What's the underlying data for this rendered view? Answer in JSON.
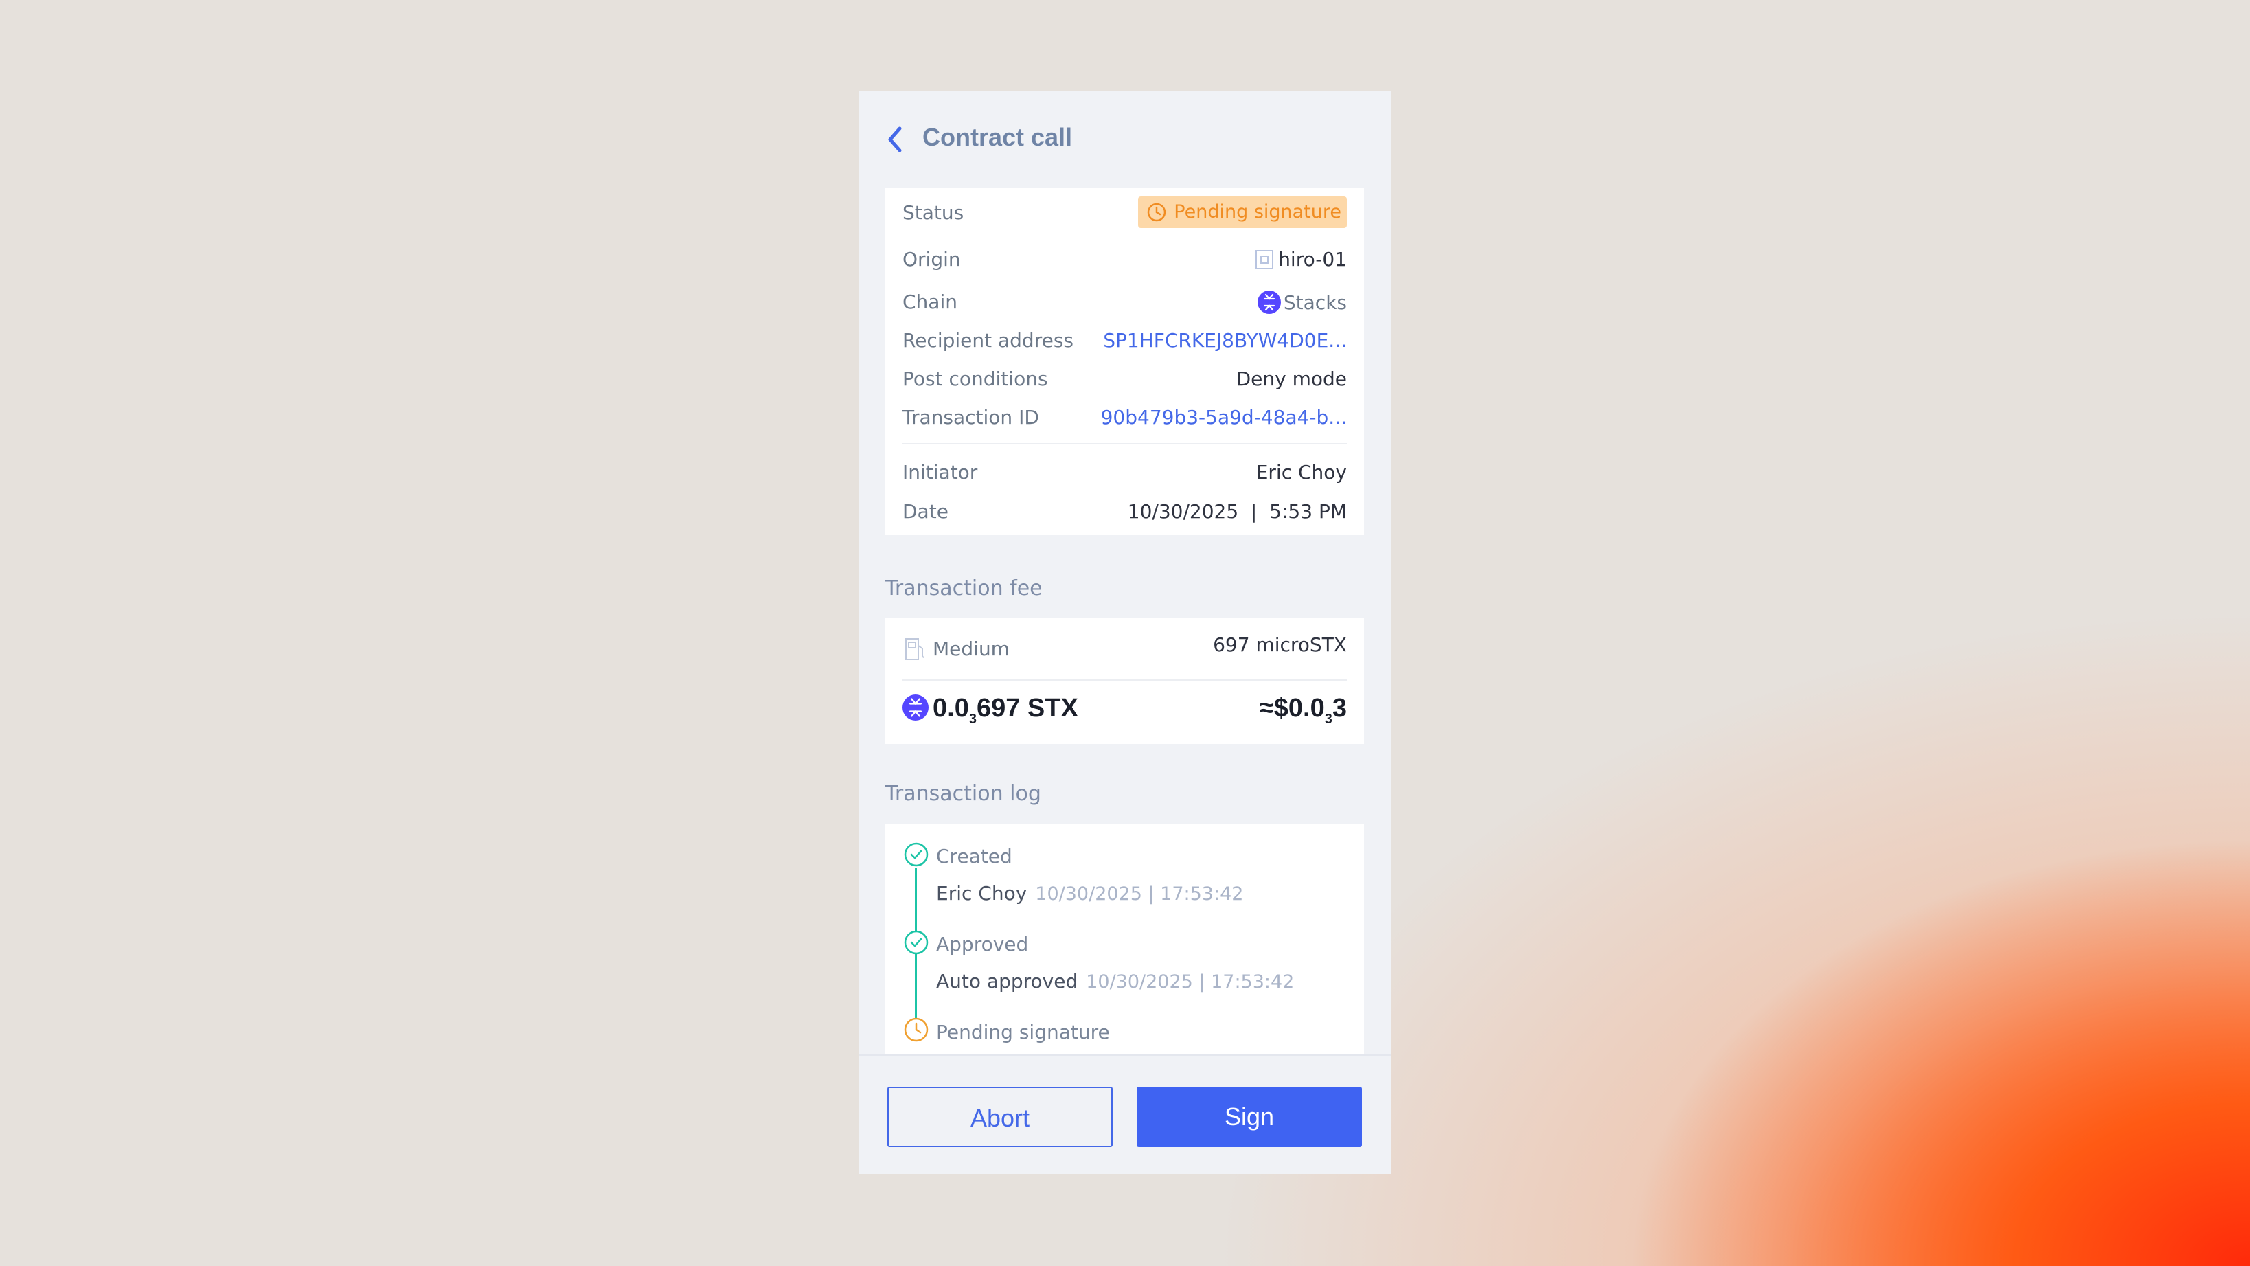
{
  "header": {
    "title": "Contract call"
  },
  "details": {
    "status": {
      "label": "Status",
      "value": "Pending signature"
    },
    "origin": {
      "label": "Origin",
      "value": "hiro-01"
    },
    "chain": {
      "label": "Chain",
      "value": "Stacks"
    },
    "recipient": {
      "label": "Recipient address",
      "value": "SP1HFCRKEJ8BYW4D0E..."
    },
    "post_conditions": {
      "label": "Post conditions",
      "value": "Deny mode"
    },
    "transaction_id": {
      "label": "Transaction ID",
      "value": "90b479b3-5a9d-48a4-b..."
    },
    "initiator": {
      "label": "Initiator",
      "value": "Eric Choy"
    },
    "date": {
      "label": "Date",
      "value": "10/30/2025  |  5:53 PM"
    }
  },
  "fee": {
    "section_title": "Transaction fee",
    "speed": "Medium",
    "amount_micro": "697 microSTX",
    "stx_prefix": "0.0",
    "stx_sub": "3",
    "stx_suffix": "697 STX",
    "usd_prefix": "≈$0.0",
    "usd_sub": "3",
    "usd_suffix": "3"
  },
  "log": {
    "section_title": "Transaction log",
    "entries": [
      {
        "status": "Created",
        "actor": "Eric Choy",
        "time": "10/30/2025 | 17:53:42"
      },
      {
        "status": "Approved",
        "actor": "Auto approved",
        "time": "10/30/2025 | 17:53:42"
      },
      {
        "status": "Pending signature"
      }
    ]
  },
  "actions": {
    "abort": "Abort",
    "sign": "Sign"
  },
  "colors": {
    "accent": "#3f63f2",
    "pending": "#f08c22",
    "success": "#1cc4a6",
    "stacks": "#5546ff"
  }
}
